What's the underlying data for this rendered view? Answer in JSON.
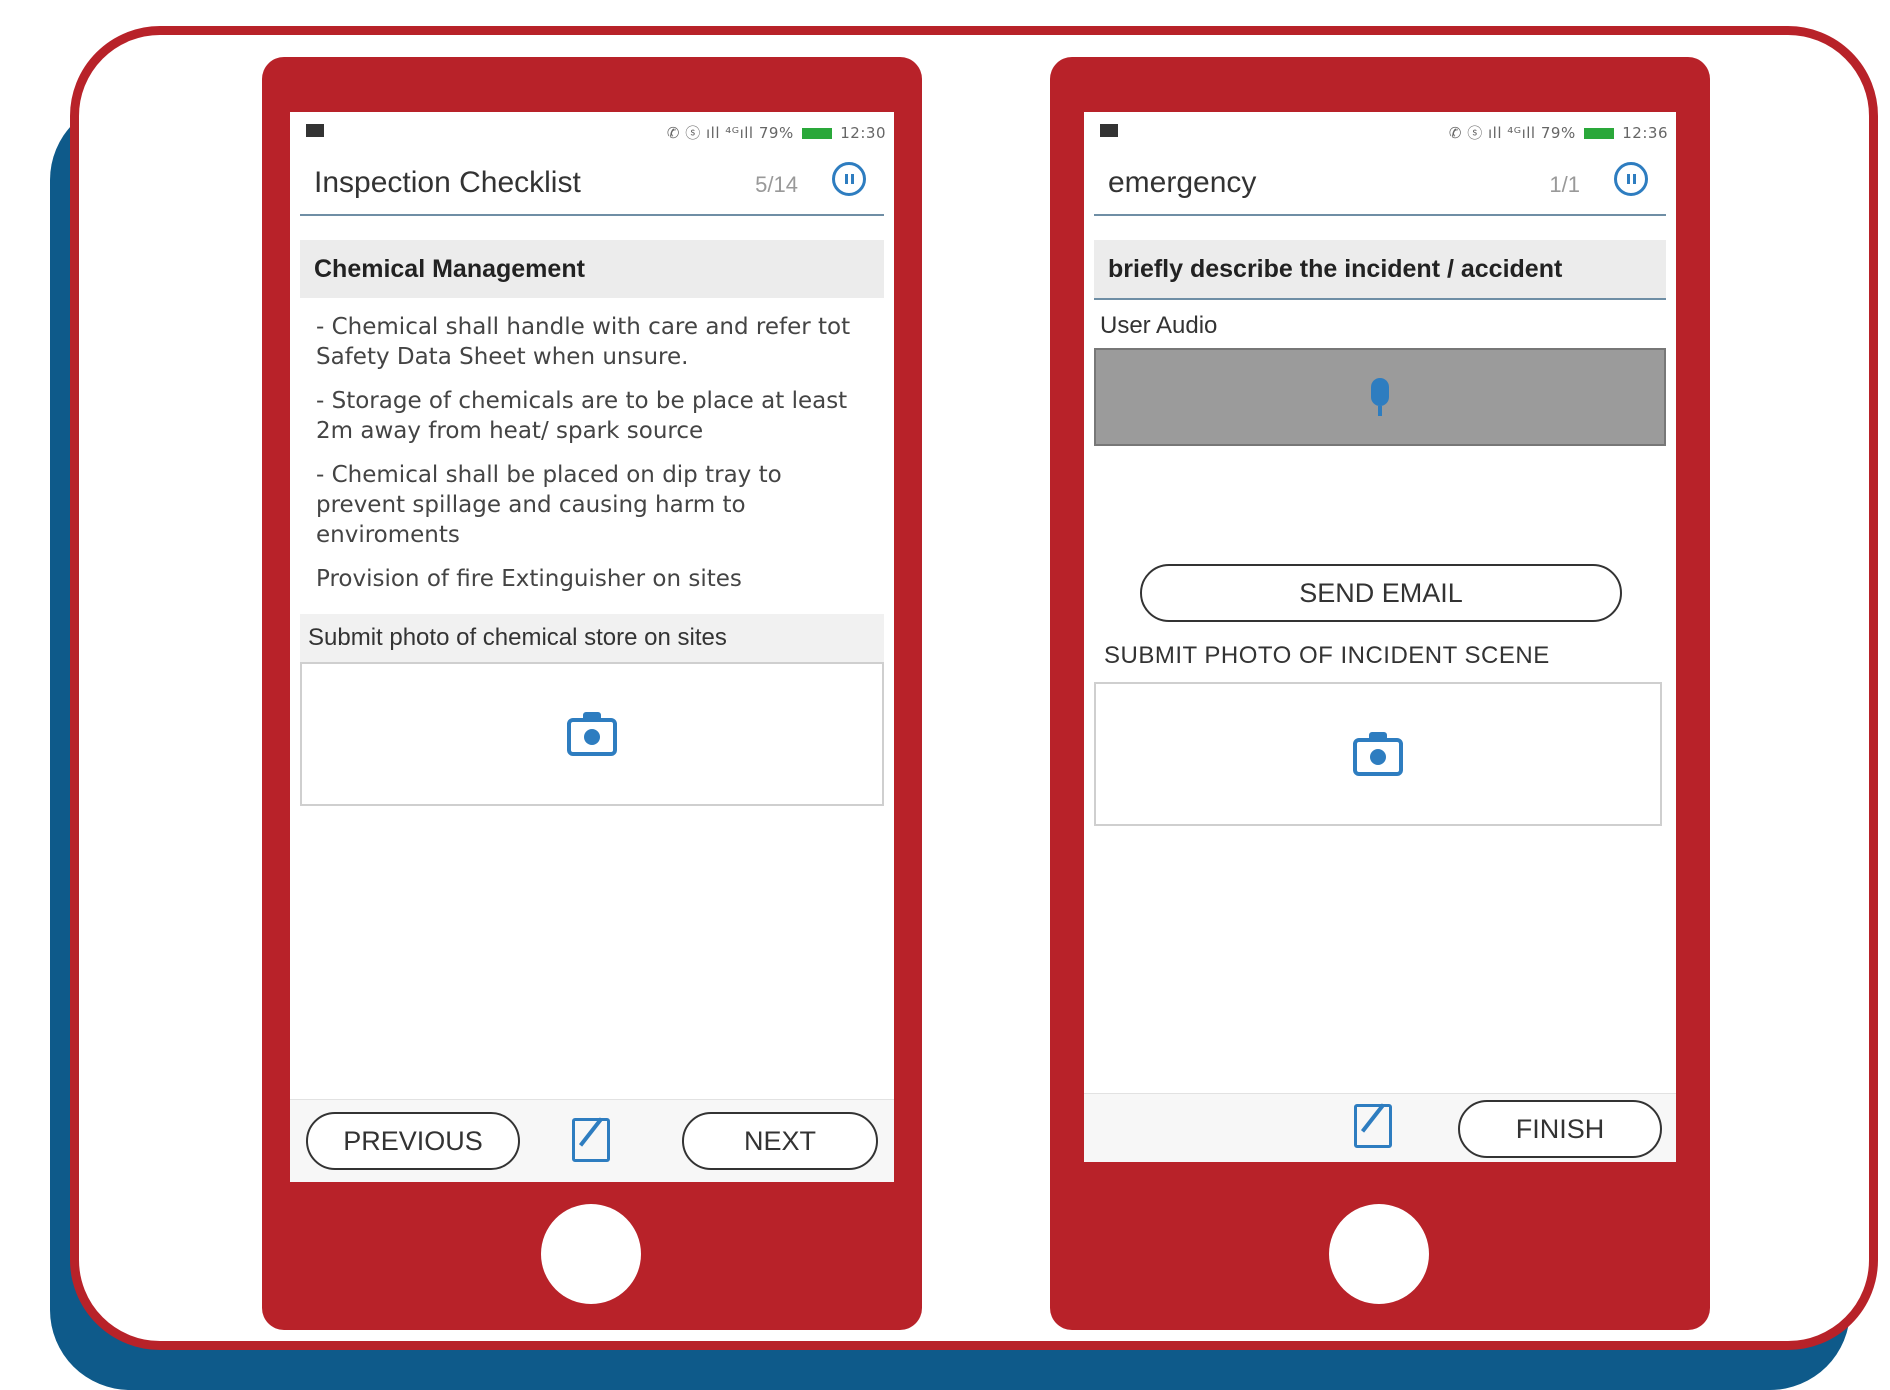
{
  "left_phone": {
    "status_text": "✆ ⓢ ıll ⁴ᴳıll 79%",
    "time": "12:30",
    "title": "Inspection Checklist",
    "counter": "5/14",
    "section_title": "Chemical Management",
    "paragraphs": [
      "- Chemical shall handle with care and refer tot Safety Data Sheet when unsure.",
      "- Storage of chemicals are to be place at least 2m away from heat/ spark source",
      "- Chemical shall be placed on dip tray to prevent spillage and causing harm to enviroments",
      "Provision of fire Extinguisher on sites"
    ],
    "photo_label": "Submit photo of chemical store on sites",
    "previous_label": "PREVIOUS",
    "next_label": "NEXT"
  },
  "right_phone": {
    "status_text": "✆ ⓢ ıll ⁴ᴳıll 79%",
    "time": "12:36",
    "title": "emergency",
    "counter": "1/1",
    "section_title": "briefly describe the incident / accident",
    "audio_label": "User Audio",
    "send_email_label": "SEND EMAIL",
    "photo_label": "SUBMIT PHOTO OF INCIDENT SCENE",
    "finish_label": "FINISH"
  },
  "colors": {
    "frame_red": "#b82229",
    "shadow_blue": "#0e5a8a",
    "accent_blue": "#2e7dc0"
  },
  "icons": [
    "pause-icon",
    "camera-icon",
    "edit-icon",
    "microphone-icon",
    "gallery-icon",
    "battery-icon"
  ]
}
